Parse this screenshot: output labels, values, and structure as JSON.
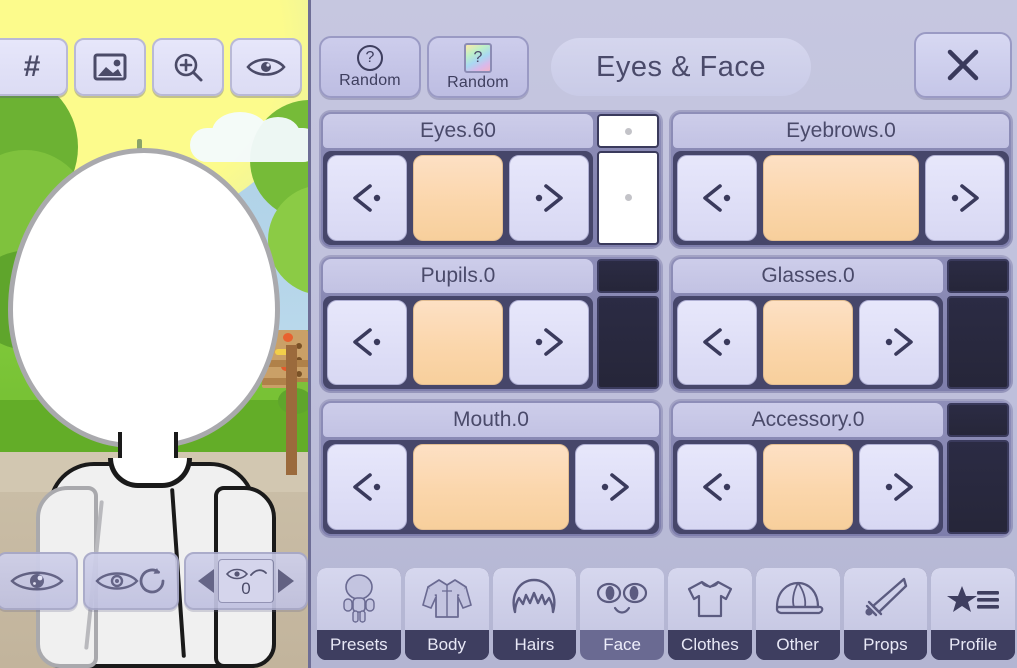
{
  "toolbar_left": {
    "buttons": [
      {
        "name": "hash-icon",
        "label": "#"
      },
      {
        "name": "image-icon",
        "label": ""
      },
      {
        "name": "zoom-in-icon",
        "label": ""
      },
      {
        "name": "eye-icon",
        "label": ""
      }
    ]
  },
  "header": {
    "random_basic_label": "Random",
    "random_color_label": "Random",
    "random_basic_icon": "question-circle-icon",
    "random_color_icon": "rainbow-question-card-icon",
    "title": "Eyes & Face",
    "close_label": "X"
  },
  "options": [
    {
      "title": "Eyes.60",
      "prev": "‹",
      "next": "›",
      "swatch_color": "#fbd6ab",
      "side_column": "white"
    },
    {
      "title": "Eyebrows.0",
      "prev": "‹",
      "next": "›",
      "swatch_color": "#fbd6ab",
      "side_column": "none"
    },
    {
      "title": "Pupils.0",
      "prev": "‹",
      "next": "›",
      "swatch_color": "#fbd6ab",
      "side_column": "dark"
    },
    {
      "title": "Glasses.0",
      "prev": "‹",
      "next": "›",
      "swatch_color": "#fbd6ab",
      "side_column": "dark"
    },
    {
      "title": "Mouth.0",
      "prev": "‹",
      "next": "›",
      "swatch_color": "#fbd6ab",
      "side_column": "none"
    },
    {
      "title": "Accessory.0",
      "prev": "‹",
      "next": "›",
      "swatch_color": "#fbd6ab",
      "side_column": "dark"
    }
  ],
  "tabs": [
    {
      "label": "Presets",
      "icon": "character-body-icon",
      "active": false
    },
    {
      "label": "Body",
      "icon": "jacket-icon",
      "active": false
    },
    {
      "label": "Hairs",
      "icon": "hair-icon",
      "active": false
    },
    {
      "label": "Face",
      "icon": "face-eyes-icon",
      "active": true
    },
    {
      "label": "Clothes",
      "icon": "tshirt-icon",
      "active": false
    },
    {
      "label": "Other",
      "icon": "cap-icon",
      "active": false
    },
    {
      "label": "Props",
      "icon": "sword-icon",
      "active": false
    },
    {
      "label": "Profile",
      "icon": "star-list-icon",
      "active": false
    }
  ],
  "bottom_left": {
    "eye_toggle_icon": "eye-pupil-icon",
    "reset_icon": "eye-reset-icon",
    "stepper": {
      "prev_icon": "triangle-left-icon",
      "next_icon": "triangle-right-icon",
      "preview_icon": "eye-eyebrow-icon",
      "value": "0"
    }
  },
  "colors": {
    "panel_bg": "#bfc0dc",
    "panel_frame": "#8e8eb8",
    "title_bar": "#cdcdea",
    "swatch": "#fbd6ab",
    "text_dark": "#4a4a6a",
    "tab_label_bg": "#3e3e60"
  }
}
